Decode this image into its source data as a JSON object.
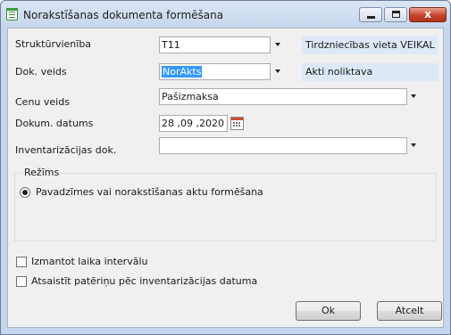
{
  "window": {
    "title": "Norakstīšanas dokumenta formēšana",
    "close_glyph": "x"
  },
  "form": {
    "struktur_label": "Struktūrvienība",
    "struktur_value": "T11",
    "struktur_info": "Tirdzniecības vieta VEIKAL",
    "dok_label": "Dok. veids",
    "dok_value": "NorAkts",
    "dok_info": "Akti noliktava",
    "cenu_label": "Cenu veids",
    "cenu_value": "Pašizmaksa",
    "datums_label": "Dokum. datums",
    "datums_value": "28 ,09 ,2020",
    "invent_label": "Inventarizācijas dok.",
    "invent_value": ""
  },
  "rezims": {
    "title": "Režīms",
    "option_label": "Pavadzīmes vai norakstīšanas aktu formēšana",
    "selected": true
  },
  "options": {
    "interval_label": "Izmantot laika intervālu",
    "interval_checked": false,
    "attach_label": "Atsaistīt patēriņu pēc inventarizācijas datuma",
    "attach_checked": false
  },
  "buttons": {
    "ok": "Ok",
    "cancel": "Atcelt"
  },
  "icons": {
    "app": "form-icon",
    "calendar": "calendar-icon"
  }
}
